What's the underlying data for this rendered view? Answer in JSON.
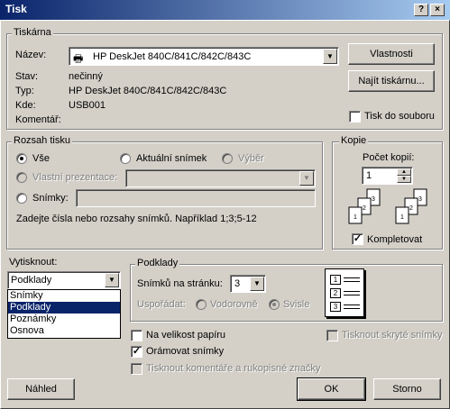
{
  "window": {
    "title": "Tisk",
    "help_btn": "?",
    "close_btn": "×"
  },
  "printer": {
    "group": "Tiskárna",
    "name_label": "Název:",
    "name_value": "HP DeskJet 840C/841C/842C/843C",
    "status_label": "Stav:",
    "status_value": "nečinný",
    "type_label": "Typ:",
    "type_value": "HP DeskJet 840C/841C/842C/843C",
    "where_label": "Kde:",
    "where_value": "USB001",
    "comment_label": "Komentář:",
    "properties_btn": "Vlastnosti",
    "find_btn": "Najít tiskárnu...",
    "print_to_file": "Tisk do souboru"
  },
  "range": {
    "group": "Rozsah tisku",
    "all": "Vše",
    "current": "Aktuální snímek",
    "selection": "Výběr",
    "custom": "Vlastní prezentace:",
    "slides": "Snímky:",
    "hint": "Zadejte čísla nebo rozsahy snímků. Například 1;3;5-12"
  },
  "copies": {
    "group": "Kopie",
    "count_label": "Počet kopií:",
    "count_value": "1",
    "collate": "Kompletovat"
  },
  "print_what": {
    "label": "Vytisknout:",
    "value": "Podklady",
    "options": [
      "Snímky",
      "Podklady",
      "Poznámky",
      "Osnova"
    ],
    "selected_index": 1
  },
  "handouts": {
    "group": "Podklady",
    "per_page_label": "Snímků na stránku:",
    "per_page_value": "3",
    "order_label": "Uspořádat:",
    "horizontal": "Vodorovně",
    "vertical": "Svisle",
    "preview_numbers": [
      "1",
      "2",
      "3"
    ]
  },
  "options": {
    "scale": "Na velikost papíru",
    "frame": "Orámovat snímky",
    "comments": "Tisknout komentáře a rukopisné značky",
    "hidden": "Tisknout skryté snímky"
  },
  "buttons": {
    "preview": "Náhled",
    "ok": "OK",
    "cancel": "Storno"
  }
}
